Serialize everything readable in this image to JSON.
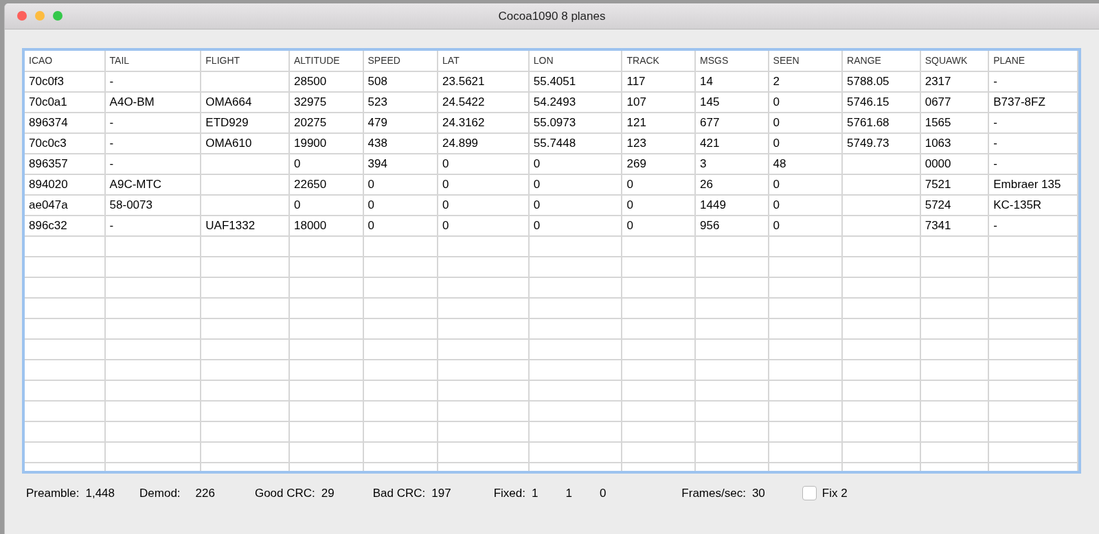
{
  "window": {
    "title": "Cocoa1090 8 planes"
  },
  "table": {
    "columns": [
      "ICAO",
      "TAIL",
      "FLIGHT",
      "ALTITUDE",
      "SPEED",
      "LAT",
      "LON",
      "TRACK",
      "MSGS",
      "SEEN",
      "RANGE",
      "SQUAWK",
      "PLANE"
    ],
    "rows": [
      [
        "70c0f3",
        "-",
        "",
        "28500",
        "508",
        "23.5621",
        "55.4051",
        "117",
        "14",
        "2",
        "5788.05",
        "2317",
        "-"
      ],
      [
        "70c0a1",
        "A4O-BM",
        "OMA664",
        "32975",
        "523",
        "24.5422",
        "54.2493",
        "107",
        "145",
        "0",
        "5746.15",
        "0677",
        "B737-8FZ"
      ],
      [
        "896374",
        "-",
        "ETD929",
        "20275",
        "479",
        "24.3162",
        "55.0973",
        "121",
        "677",
        "0",
        "5761.68",
        "1565",
        "-"
      ],
      [
        "70c0c3",
        "-",
        "OMA610",
        "19900",
        "438",
        "24.899",
        "55.7448",
        "123",
        "421",
        "0",
        "5749.73",
        "1063",
        "-"
      ],
      [
        "896357",
        "-",
        "",
        "0",
        "394",
        "0",
        "0",
        "269",
        "3",
        "48",
        "",
        "0000",
        "-"
      ],
      [
        "894020",
        "A9C-MTC",
        "",
        "22650",
        "0",
        "0",
        "0",
        "0",
        "26",
        "0",
        "",
        "7521",
        "Embraer 135"
      ],
      [
        "ae047a",
        "58-0073",
        "",
        "0",
        "0",
        "0",
        "0",
        "0",
        "1449",
        "0",
        "",
        "5724",
        "KC-135R"
      ],
      [
        "896c32",
        "-",
        "UAF1332",
        "18000",
        "0",
        "0",
        "0",
        "0",
        "956",
        "0",
        "",
        "7341",
        "-"
      ]
    ]
  },
  "status_bar": {
    "stats": [
      {
        "label": "Preamble:",
        "values": [
          "1,448"
        ]
      },
      {
        "label": "Demod:",
        "values": [
          "226"
        ]
      },
      {
        "label": "Good CRC:",
        "values": [
          "29"
        ]
      },
      {
        "label": "Bad CRC:",
        "values": [
          "197"
        ]
      },
      {
        "label": "Fixed:",
        "values": [
          "1",
          "1",
          "0"
        ]
      },
      {
        "label": "Frames/sec:",
        "values": [
          "30"
        ]
      }
    ],
    "checkbox": {
      "label": "Fix 2",
      "checked": false
    }
  }
}
